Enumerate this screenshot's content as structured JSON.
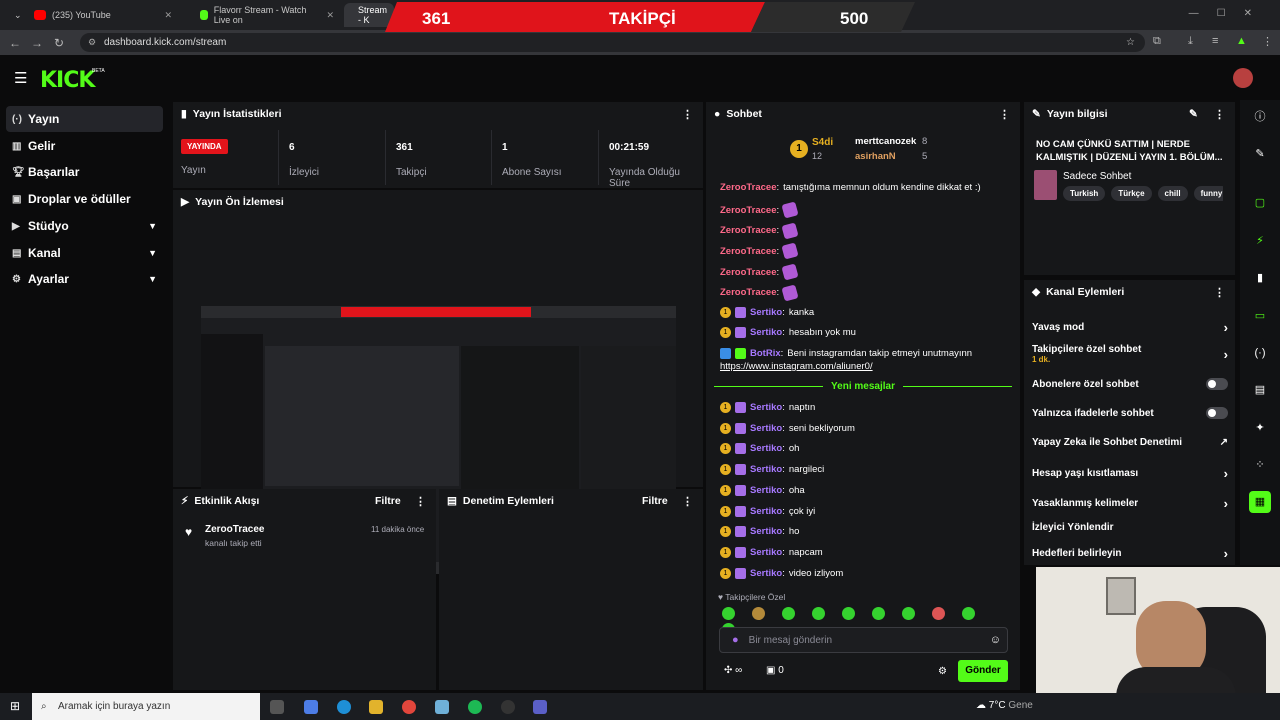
{
  "browser": {
    "tabs": [
      {
        "title": "(235) YouTube",
        "color": "#ff0000"
      },
      {
        "title": "Flavorr Stream - Watch Live on",
        "color": "#53fc18"
      },
      {
        "title": "Stream - K",
        "color": "#53fc18"
      }
    ],
    "url": "dashboard.kick.com/stream"
  },
  "banner": {
    "current": "361",
    "label": "TAKİPÇİ",
    "goal": "500",
    "progress_fraction": 0.722
  },
  "brand": {
    "logo": "KICK",
    "beta": "BETA",
    "accent": "#53fc18"
  },
  "sidebar": {
    "items": [
      {
        "label": "Yayın",
        "icon": "broadcast-icon",
        "active": true
      },
      {
        "label": "Gelir",
        "icon": "bar-chart-icon"
      },
      {
        "label": "Başarılar",
        "icon": "trophy-icon"
      },
      {
        "label": "Droplar ve ödüller",
        "icon": "gift-icon"
      },
      {
        "label": "Stüdyo",
        "icon": "video-icon",
        "expandable": true
      },
      {
        "label": "Kanal",
        "icon": "channel-icon",
        "expandable": true
      },
      {
        "label": "Ayarlar",
        "icon": "gear-icon",
        "expandable": true
      }
    ]
  },
  "stats": {
    "title": "Yayın İstatistikleri",
    "status_badge": "YAYINDA",
    "status_label": "Yayın",
    "viewers": {
      "value": "6",
      "label": "İzleyici"
    },
    "followers": {
      "value": "361",
      "label": "Takipçi"
    },
    "subs": {
      "value": "1",
      "label": "Abone Sayısı"
    },
    "uptime": {
      "value": "00:21:59",
      "label": "Yayında Olduğu Süre"
    }
  },
  "preview": {
    "title": "Yayın Ön İzlemesi"
  },
  "activity": {
    "title": "Etkinlik Akışı",
    "filter": "Filtre",
    "events": [
      {
        "user": "ZerooTracee",
        "action": "kanalı takip etti",
        "time": "11 dakika önce"
      }
    ]
  },
  "moderation": {
    "title": "Denetim Eylemleri",
    "filter": "Filtre"
  },
  "chat": {
    "title": "Sohbet",
    "leaders": {
      "top_name": "S4di",
      "top_count": "12",
      "second": "merttcanozek",
      "second_count": "8",
      "third": "asirhanN",
      "third_count": "5"
    },
    "messages": [
      {
        "user": "ZerooTracee",
        "text": "tanıştığıma memnun oldum kendine dikkat et :)",
        "color": "#ff6a8a",
        "emote": false
      },
      {
        "user": "ZerooTracee",
        "text": "",
        "color": "#ff6a8a",
        "emote": true
      },
      {
        "user": "ZerooTracee",
        "text": "",
        "color": "#ff6a8a",
        "emote": true
      },
      {
        "user": "ZerooTracee",
        "text": "",
        "color": "#ff6a8a",
        "emote": true
      },
      {
        "user": "ZerooTracee",
        "text": "",
        "color": "#ff6a8a",
        "emote": true
      },
      {
        "user": "ZerooTracee",
        "text": "",
        "color": "#ff6a8a",
        "emote": true
      },
      {
        "user": "Sertiko",
        "text": "kanka",
        "color": "#a779ff",
        "emote": false
      },
      {
        "user": "Sertiko",
        "text": "hesabın yok mu",
        "color": "#a779ff",
        "emote": false
      },
      {
        "user": "BotRix",
        "text": "Beni instagramdan takip etmeyi unutmayınn",
        "color": "#a779ff",
        "emote": false
      }
    ],
    "link": "https://www.instagram.com/aliuner0/",
    "divider": "Yeni mesajlar",
    "new_messages": [
      {
        "user": "Sertiko",
        "text": "naptın"
      },
      {
        "user": "Sertiko",
        "text": "seni bekliyorum"
      },
      {
        "user": "Sertiko",
        "text": "oh"
      },
      {
        "user": "Sertiko",
        "text": "nargileci"
      },
      {
        "user": "Sertiko",
        "text": "oha"
      },
      {
        "user": "Sertiko",
        "text": "çok iyi"
      },
      {
        "user": "Sertiko",
        "text": "ho"
      },
      {
        "user": "Sertiko",
        "text": "napcam"
      },
      {
        "user": "Sertiko",
        "text": "video izliyom"
      }
    ],
    "followers_only": "Takipçilere Özel",
    "input_placeholder": "Bir mesaj gönderin",
    "points": "∞",
    "gifts": "0",
    "send": "Gönder"
  },
  "streaminfo": {
    "title": "Yayın bilgisi",
    "stream_title": "NO CAM ÇÜNKÜ SATTIM | NERDE KALMIŞTIK | DÜZENLİ YAYIN 1. BÖLÜM...",
    "category": "Sadece Sohbet",
    "tags": [
      "Turkish",
      "Türkçe",
      "chill",
      "funny"
    ]
  },
  "channel_actions": {
    "title": "Kanal Eylemleri",
    "items": [
      {
        "label": "Yavaş mod",
        "control": "arrow"
      },
      {
        "label": "Takipçilere özel sohbet",
        "sub": "1 dk.",
        "control": "arrow"
      },
      {
        "label": "Abonelere özel sohbet",
        "control": "toggle"
      },
      {
        "label": "Yalnızca ifadelerle sohbet",
        "control": "toggle"
      },
      {
        "label": "Yapay Zeka ile Sohbet Denetimi",
        "control": "external"
      },
      {
        "label": "Hesap yaşı kısıtlaması",
        "control": "arrow"
      },
      {
        "label": "Yasaklanmış kelimeler",
        "control": "arrow"
      },
      {
        "label": "İzleyici Yönlendir",
        "control": "none"
      },
      {
        "label": "Hedefleri belirleyin",
        "control": "arrow"
      }
    ]
  },
  "taskbar": {
    "search_placeholder": "Aramak için buraya yazın",
    "weather": "7°C",
    "weather_text": "Gene"
  }
}
